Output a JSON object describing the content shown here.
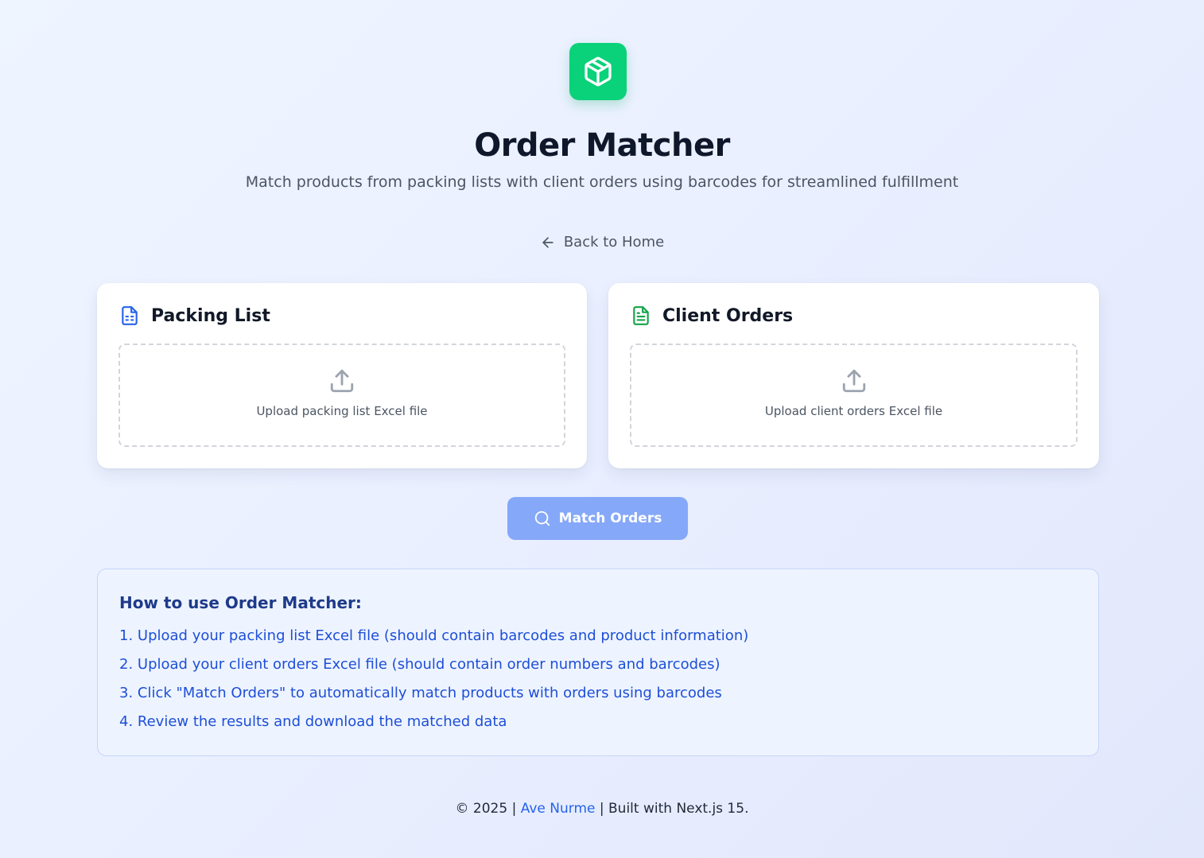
{
  "header": {
    "logo_icon": "package-box-icon",
    "title": "Order Matcher",
    "subtitle": "Match products from packing lists with client orders using barcodes for streamlined fulfillment"
  },
  "nav": {
    "back_icon": "arrow-left-icon",
    "back_label": "Back to Home"
  },
  "packing_card": {
    "icon": "spreadsheet-file-icon",
    "title": "Packing List",
    "upload_icon": "upload-icon",
    "upload_label": "Upload packing list Excel file"
  },
  "orders_card": {
    "icon": "text-file-icon",
    "title": "Client Orders",
    "upload_icon": "upload-icon",
    "upload_label": "Upload client orders Excel file"
  },
  "action": {
    "icon": "search-icon",
    "label": "Match Orders"
  },
  "instructions": {
    "title": "How to use Order Matcher:",
    "steps": [
      "1. Upload your packing list Excel file (should contain barcodes and product information)",
      "2. Upload your client orders Excel file (should contain order numbers and barcodes)",
      "3. Click \"Match Orders\" to automatically match products with orders using barcodes",
      "4. Review the results and download the matched data"
    ]
  },
  "footer": {
    "prefix": "© 2025 | ",
    "author": "Ave Nurme",
    "suffix": " | Built with Next.js 15."
  },
  "colors": {
    "logo_bg": "#0ad27a",
    "button_bg": "#85a8f9",
    "packing_icon": "#2563eb",
    "orders_icon": "#16a34a",
    "link": "#2563eb",
    "info_text": "#1d4ed8"
  }
}
